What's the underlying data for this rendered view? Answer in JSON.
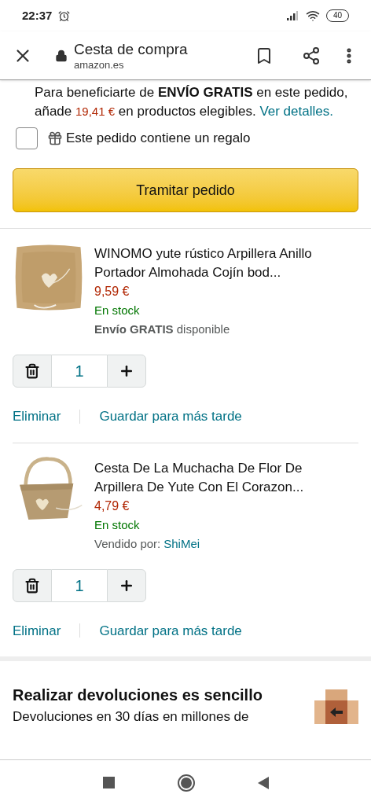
{
  "status_bar": {
    "time": "22:37",
    "battery": "40"
  },
  "browser": {
    "title": "Cesta de compra",
    "url": "amazon.es"
  },
  "shipping_notice": {
    "text": "Para beneficiarte de **ENVÍO GRATIS** en este pedido, añade",
    "amount": "19,41 €",
    "text_after": "en productos elegibles.",
    "link": "Ver detalles."
  },
  "gift_option": {
    "label": "Este pedido contiene un regalo",
    "checked": false
  },
  "checkout_button": "Tramitar pedido",
  "items": [
    {
      "kind": "pillow",
      "title": "WINOMO yute rústico Arpillera Anillo Portador Almohada Cojín bod...",
      "price": "9,59 €",
      "stock": "En stock",
      "note": {
        "kind": "shipping",
        "text": "**Envío GRATIS** disponible"
      },
      "quantity": "1",
      "actions": [
        "Eliminar",
        "Guardar para más tarde"
      ]
    },
    {
      "kind": "basket",
      "title": "Cesta De La Muchacha De Flor De Arpillera De Yute Con El Corazon...",
      "price": "4,79 €",
      "stock": "En stock",
      "note": {
        "kind": "seller",
        "text": "Vendido por:",
        "seller": "ShiMei"
      },
      "quantity": "1",
      "actions": [
        "Eliminar",
        "Guardar para más tarde"
      ]
    }
  ],
  "returns": {
    "title": "Realizar devoluciones es sencillo",
    "text": "Devoluciones en 30 días en millones de"
  }
}
